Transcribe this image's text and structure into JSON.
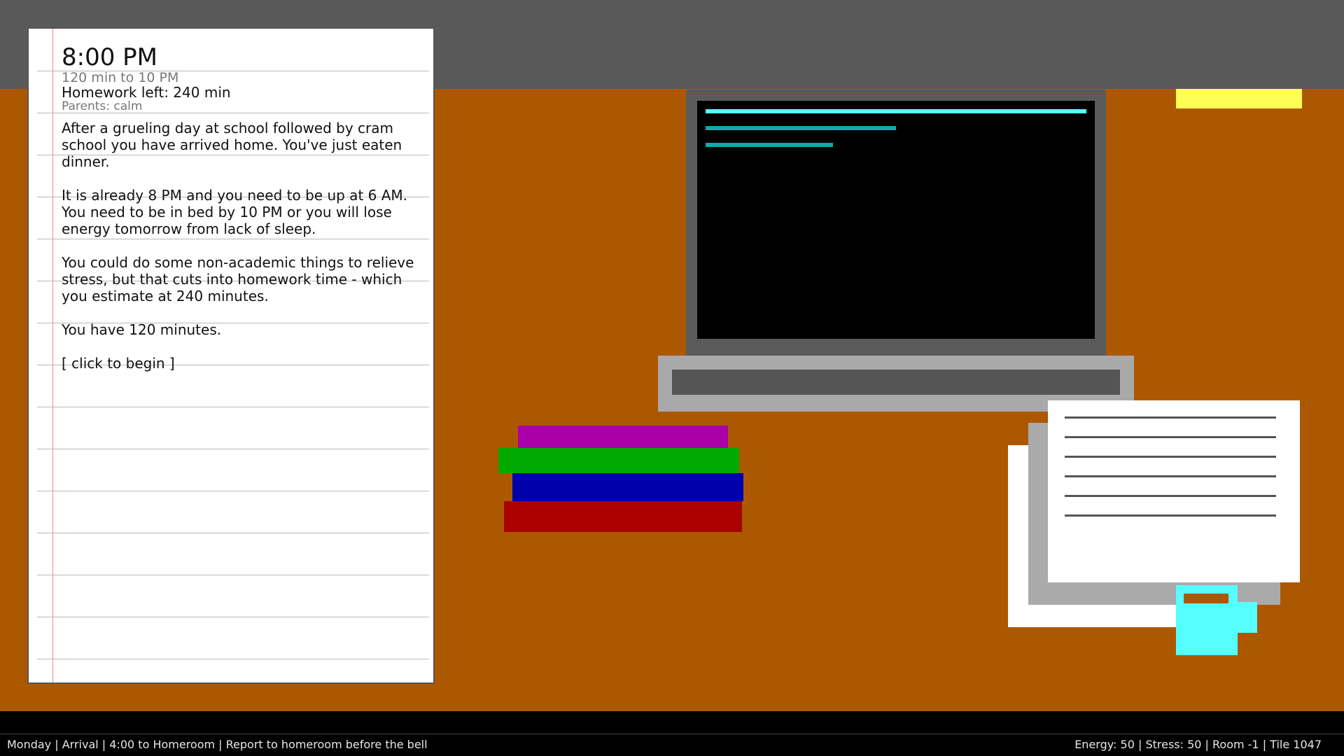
{
  "notebook": {
    "time": "8:00 PM",
    "time_to_bed": "120 min to 10 PM",
    "homework_left": "Homework left: 240 min",
    "parents": "Parents: calm",
    "paragraphs": [
      "After a grueling day at school followed by cram school you have arrived home. You've just eaten dinner.",
      "It is already 8 PM and you need to be up at 6 AM. You need to be in bed by 10 PM or you will lose energy tomorrow from lack of sleep.",
      "You could do some non-academic things to relieve stress, but that cuts into homework time - which you estimate at 240 minutes.",
      "You have 120 minutes."
    ],
    "begin_prompt": "[ click to begin ]"
  },
  "status_bar": {
    "left": "Monday | Arrival | 4:00 to Homeroom | Report to homeroom before the bell",
    "right": "Energy: 50 | Stress: 50 | Room -1 | Tile 1047"
  },
  "colors": {
    "desk": "#ac5800",
    "wall": "#595959",
    "screen_code_bright": "#55ffff",
    "screen_code_dim": "#11aaaa",
    "sticky_note": "#ffff55",
    "book_magenta": "#aa00aa",
    "book_green": "#00aa00",
    "book_blue": "#0000aa",
    "book_red": "#aa0000",
    "mug": "#55ffff"
  }
}
